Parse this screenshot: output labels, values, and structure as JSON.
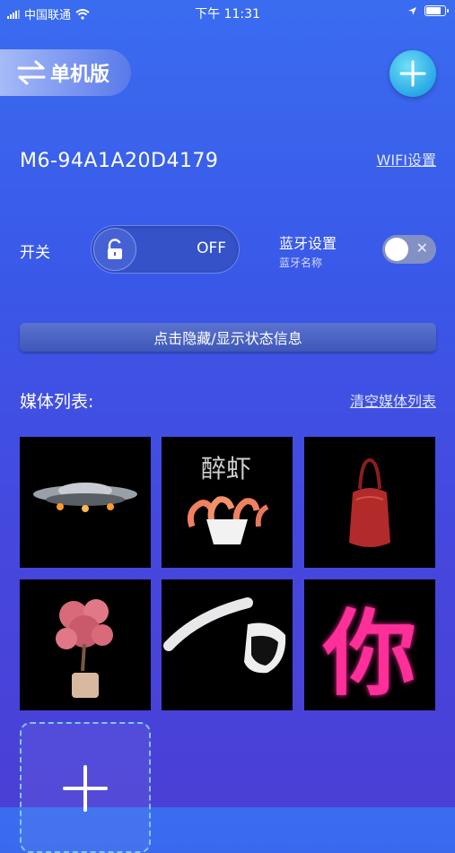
{
  "status": {
    "carrier": "中国联通",
    "time": "下午 11:31",
    "battery_level": 0.9
  },
  "header": {
    "mode_label": "单机版"
  },
  "device": {
    "name": "M6-94A1A20D4179",
    "wifi_label": "WIFI设置"
  },
  "power": {
    "label": "开关",
    "state": "OFF"
  },
  "bluetooth": {
    "title": "蓝牙设置",
    "subtitle": "蓝牙名称",
    "enabled": false
  },
  "status_toggle_label": "点击隐藏/显示状态信息",
  "media": {
    "title": "媒体列表:",
    "clear_label": "清空媒体列表",
    "items": [
      {
        "name": "ufo-spaceship"
      },
      {
        "name": "drunken-shrimp",
        "caption": "醉虾"
      },
      {
        "name": "red-handbag"
      },
      {
        "name": "pink-tree-bonsai"
      },
      {
        "name": "vr-headset"
      },
      {
        "name": "neon-character",
        "caption": "你"
      }
    ]
  },
  "colors": {
    "accent": "#2aa8e8",
    "neon_pink": "#ff2f9a"
  }
}
